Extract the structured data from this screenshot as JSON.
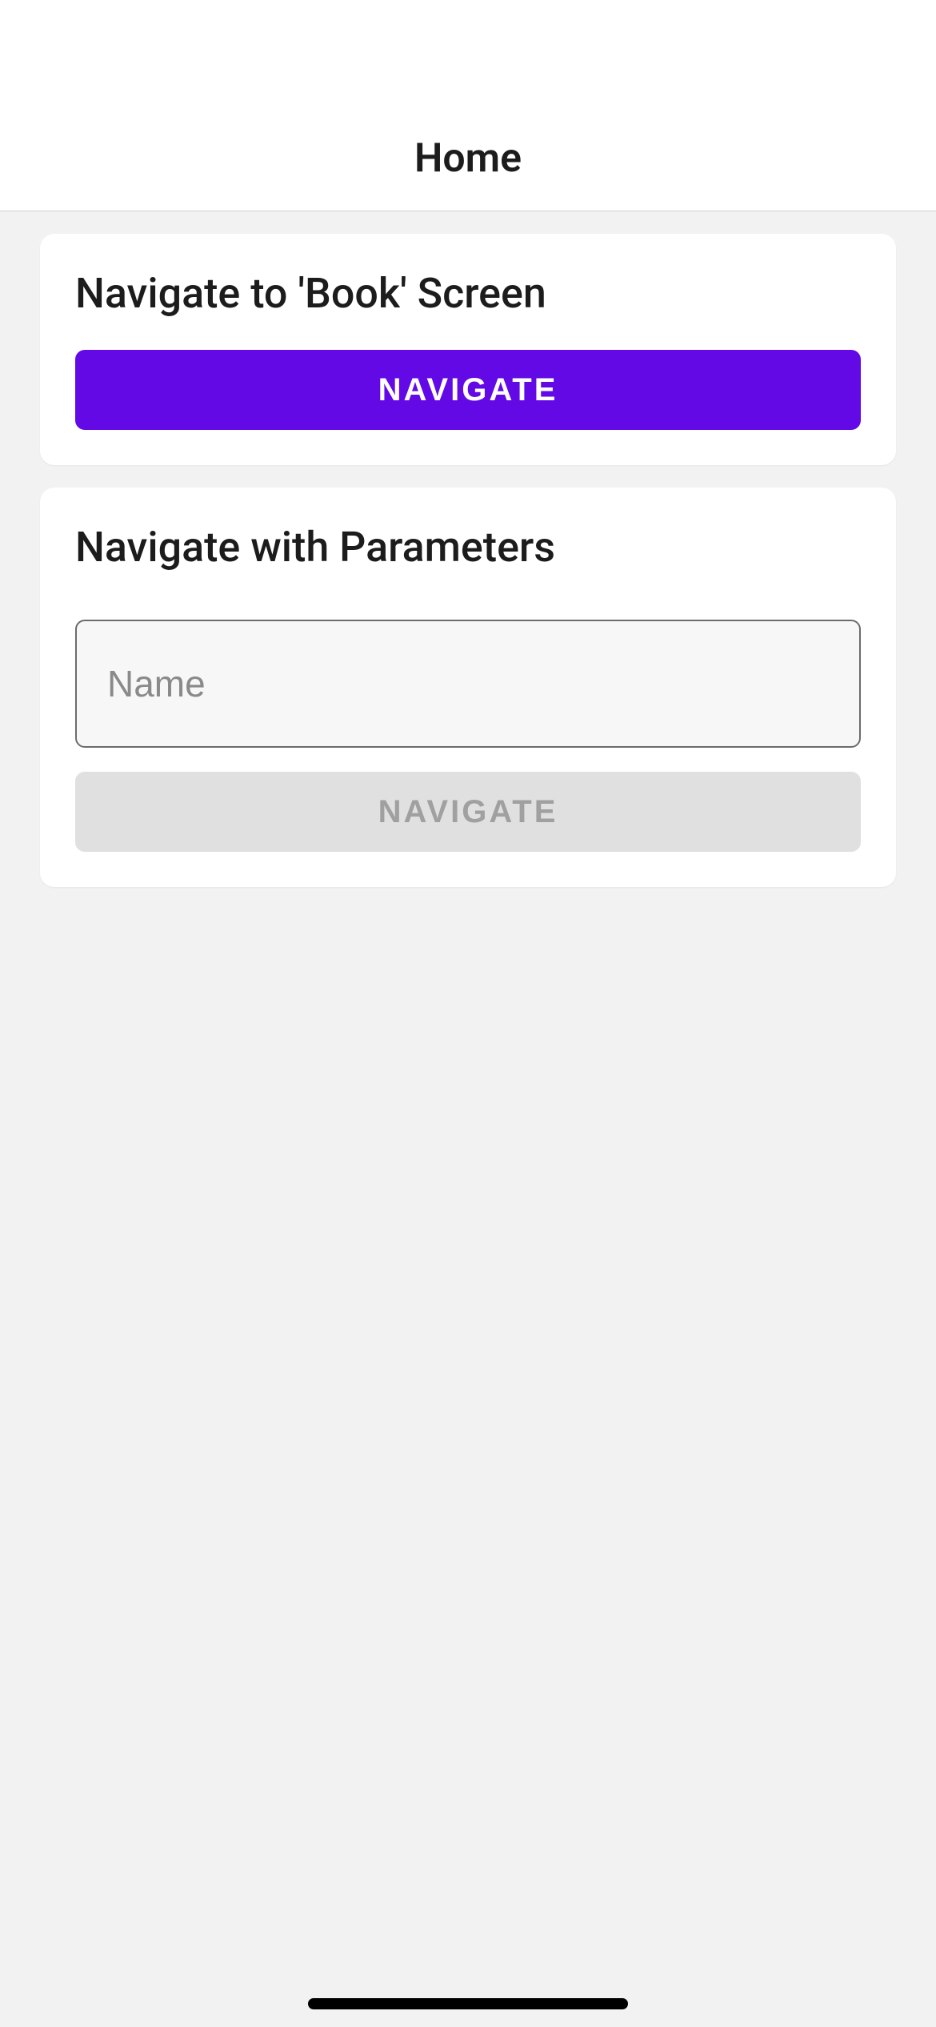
{
  "navBar": {
    "title": "Home"
  },
  "cards": {
    "bookNavigate": {
      "title": "Navigate to 'Book' Screen",
      "buttonLabel": "NAVIGATE"
    },
    "paramsNavigate": {
      "title": "Navigate with Parameters",
      "namePlaceholder": "Name",
      "nameValue": "",
      "buttonLabel": "NAVIGATE"
    }
  },
  "colors": {
    "primary": "#6209e6",
    "disabledBg": "#e0e0e0",
    "disabledText": "#a0a0a0"
  }
}
